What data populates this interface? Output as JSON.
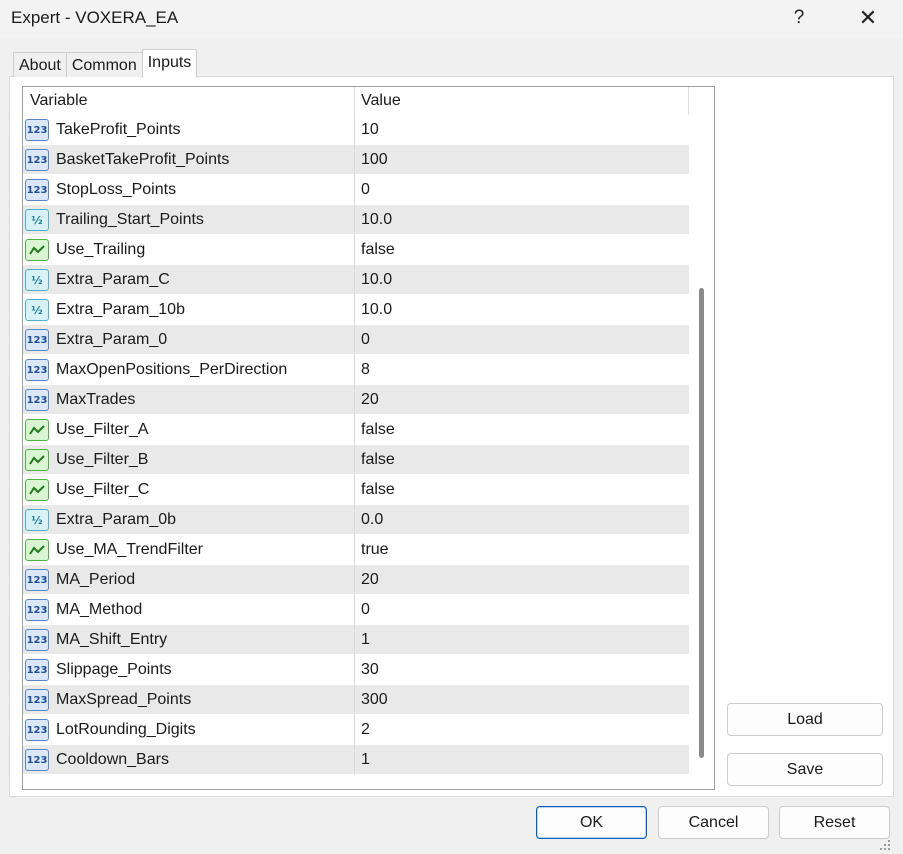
{
  "window": {
    "title": "Expert - VOXERA_EA",
    "help_label": "?",
    "close_label": "✕"
  },
  "tabs": [
    {
      "label": "About",
      "active": false
    },
    {
      "label": "Common",
      "active": false
    },
    {
      "label": "Inputs",
      "active": true
    }
  ],
  "grid": {
    "headers": {
      "variable": "Variable",
      "value": "Value"
    },
    "rows": [
      {
        "type": "int",
        "name": "TakeProfit_Points",
        "value": "10"
      },
      {
        "type": "int",
        "name": "BasketTakeProfit_Points",
        "value": "100"
      },
      {
        "type": "int",
        "name": "StopLoss_Points",
        "value": "0"
      },
      {
        "type": "double",
        "name": "Trailing_Start_Points",
        "value": "10.0"
      },
      {
        "type": "bool",
        "name": "Use_Trailing",
        "value": "false"
      },
      {
        "type": "double",
        "name": "Extra_Param_C",
        "value": "10.0"
      },
      {
        "type": "double",
        "name": "Extra_Param_10b",
        "value": "10.0"
      },
      {
        "type": "int",
        "name": "Extra_Param_0",
        "value": "0"
      },
      {
        "type": "int",
        "name": "MaxOpenPositions_PerDirection",
        "value": "8"
      },
      {
        "type": "int",
        "name": "MaxTrades",
        "value": "20"
      },
      {
        "type": "bool",
        "name": "Use_Filter_A",
        "value": "false"
      },
      {
        "type": "bool",
        "name": "Use_Filter_B",
        "value": "false"
      },
      {
        "type": "bool",
        "name": "Use_Filter_C",
        "value": "false"
      },
      {
        "type": "double",
        "name": "Extra_Param_0b",
        "value": "0.0"
      },
      {
        "type": "bool",
        "name": "Use_MA_TrendFilter",
        "value": "true"
      },
      {
        "type": "int",
        "name": "MA_Period",
        "value": "20"
      },
      {
        "type": "int",
        "name": "MA_Method",
        "value": "0"
      },
      {
        "type": "int",
        "name": "MA_Shift_Entry",
        "value": "1"
      },
      {
        "type": "int",
        "name": "Slippage_Points",
        "value": "30"
      },
      {
        "type": "int",
        "name": "MaxSpread_Points",
        "value": "300"
      },
      {
        "type": "int",
        "name": "LotRounding_Digits",
        "value": "2"
      },
      {
        "type": "int",
        "name": "Cooldown_Bars",
        "value": "1"
      }
    ]
  },
  "icons": {
    "int": {
      "name": "integer-type-icon",
      "glyph": "123"
    },
    "double": {
      "name": "double-type-icon",
      "glyph": "½"
    },
    "bool": {
      "name": "boolean-type-icon",
      "glyph": ""
    }
  },
  "side_buttons": {
    "load": "Load",
    "save": "Save"
  },
  "footer_buttons": {
    "ok": "OK",
    "cancel": "Cancel",
    "reset": "Reset"
  }
}
